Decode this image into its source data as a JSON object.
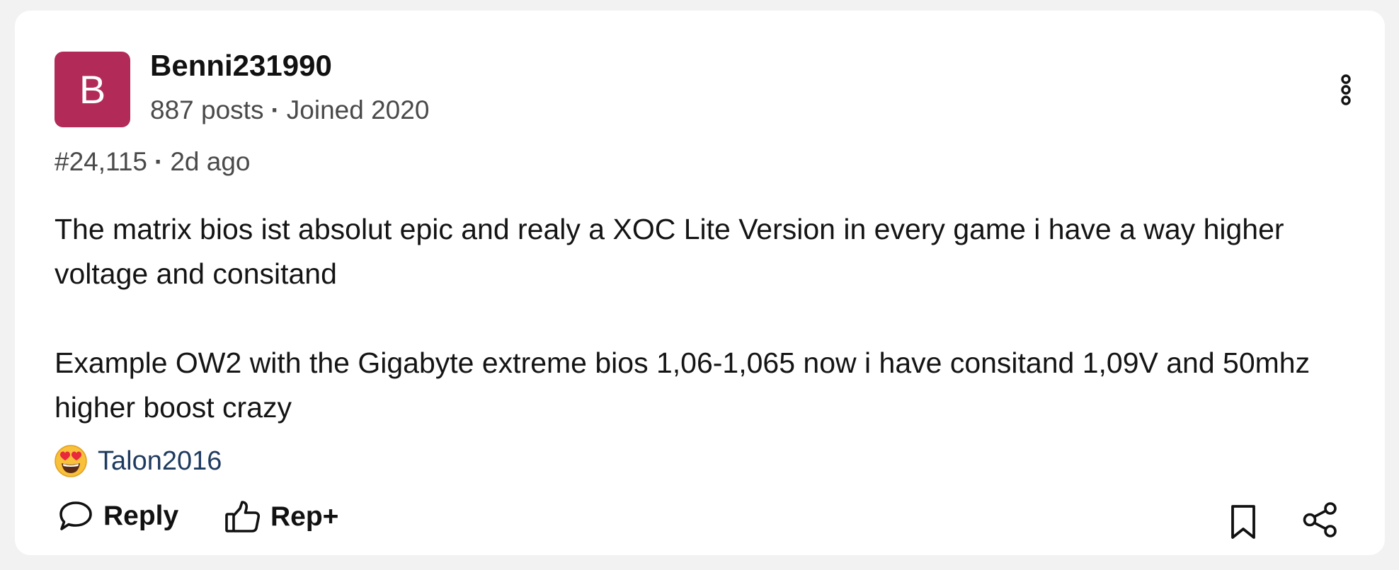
{
  "post": {
    "author": {
      "avatar_letter": "B",
      "avatar_color": "#b22a58",
      "name": "Benni231990",
      "posts": "887 posts",
      "separator": "·",
      "joined": "Joined 2020"
    },
    "number": "#24,115",
    "separator": "·",
    "time": "2d ago",
    "body": [
      "The matrix bios ist absolut epic and realy a XOC Lite Version in every game i have a way higher voltage and consitand",
      "Example OW2 with the Gigabyte extreme bios 1,06-1,065 now i have consitand 1,09V and 50mhz higher boost crazy"
    ],
    "reaction": {
      "icon": "heart-eyes-emoji-icon",
      "user": "Talon2016"
    },
    "actions": {
      "reply_label": "Reply",
      "rep_label": "Rep+",
      "reply_icon": "speech-bubble-icon",
      "rep_icon": "thumbs-up-icon",
      "bookmark_icon": "bookmark-icon",
      "share_icon": "share-icon",
      "more_icon": "vertical-ellipsis-icon"
    }
  }
}
